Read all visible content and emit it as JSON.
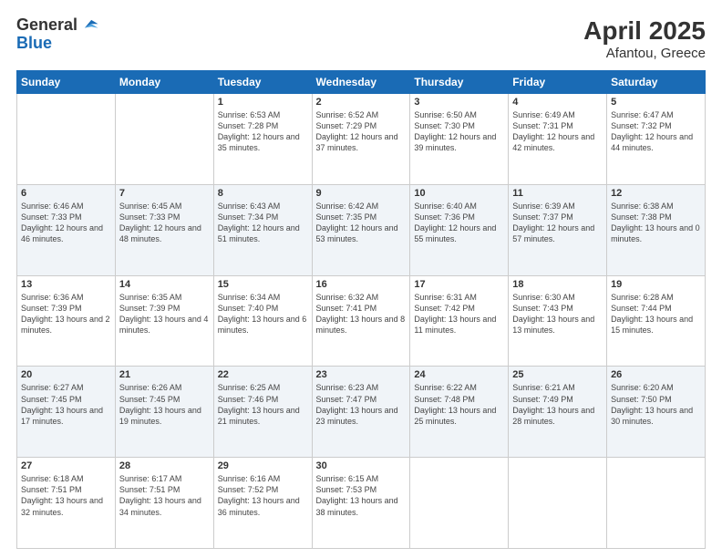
{
  "header": {
    "logo_general": "General",
    "logo_blue": "Blue",
    "month_year": "April 2025",
    "location": "Afantou, Greece"
  },
  "weekdays": [
    "Sunday",
    "Monday",
    "Tuesday",
    "Wednesday",
    "Thursday",
    "Friday",
    "Saturday"
  ],
  "weeks": [
    [
      {
        "day": "",
        "info": ""
      },
      {
        "day": "",
        "info": ""
      },
      {
        "day": "1",
        "info": "Sunrise: 6:53 AM\nSunset: 7:28 PM\nDaylight: 12 hours and 35 minutes."
      },
      {
        "day": "2",
        "info": "Sunrise: 6:52 AM\nSunset: 7:29 PM\nDaylight: 12 hours and 37 minutes."
      },
      {
        "day": "3",
        "info": "Sunrise: 6:50 AM\nSunset: 7:30 PM\nDaylight: 12 hours and 39 minutes."
      },
      {
        "day": "4",
        "info": "Sunrise: 6:49 AM\nSunset: 7:31 PM\nDaylight: 12 hours and 42 minutes."
      },
      {
        "day": "5",
        "info": "Sunrise: 6:47 AM\nSunset: 7:32 PM\nDaylight: 12 hours and 44 minutes."
      }
    ],
    [
      {
        "day": "6",
        "info": "Sunrise: 6:46 AM\nSunset: 7:33 PM\nDaylight: 12 hours and 46 minutes."
      },
      {
        "day": "7",
        "info": "Sunrise: 6:45 AM\nSunset: 7:33 PM\nDaylight: 12 hours and 48 minutes."
      },
      {
        "day": "8",
        "info": "Sunrise: 6:43 AM\nSunset: 7:34 PM\nDaylight: 12 hours and 51 minutes."
      },
      {
        "day": "9",
        "info": "Sunrise: 6:42 AM\nSunset: 7:35 PM\nDaylight: 12 hours and 53 minutes."
      },
      {
        "day": "10",
        "info": "Sunrise: 6:40 AM\nSunset: 7:36 PM\nDaylight: 12 hours and 55 minutes."
      },
      {
        "day": "11",
        "info": "Sunrise: 6:39 AM\nSunset: 7:37 PM\nDaylight: 12 hours and 57 minutes."
      },
      {
        "day": "12",
        "info": "Sunrise: 6:38 AM\nSunset: 7:38 PM\nDaylight: 13 hours and 0 minutes."
      }
    ],
    [
      {
        "day": "13",
        "info": "Sunrise: 6:36 AM\nSunset: 7:39 PM\nDaylight: 13 hours and 2 minutes."
      },
      {
        "day": "14",
        "info": "Sunrise: 6:35 AM\nSunset: 7:39 PM\nDaylight: 13 hours and 4 minutes."
      },
      {
        "day": "15",
        "info": "Sunrise: 6:34 AM\nSunset: 7:40 PM\nDaylight: 13 hours and 6 minutes."
      },
      {
        "day": "16",
        "info": "Sunrise: 6:32 AM\nSunset: 7:41 PM\nDaylight: 13 hours and 8 minutes."
      },
      {
        "day": "17",
        "info": "Sunrise: 6:31 AM\nSunset: 7:42 PM\nDaylight: 13 hours and 11 minutes."
      },
      {
        "day": "18",
        "info": "Sunrise: 6:30 AM\nSunset: 7:43 PM\nDaylight: 13 hours and 13 minutes."
      },
      {
        "day": "19",
        "info": "Sunrise: 6:28 AM\nSunset: 7:44 PM\nDaylight: 13 hours and 15 minutes."
      }
    ],
    [
      {
        "day": "20",
        "info": "Sunrise: 6:27 AM\nSunset: 7:45 PM\nDaylight: 13 hours and 17 minutes."
      },
      {
        "day": "21",
        "info": "Sunrise: 6:26 AM\nSunset: 7:45 PM\nDaylight: 13 hours and 19 minutes."
      },
      {
        "day": "22",
        "info": "Sunrise: 6:25 AM\nSunset: 7:46 PM\nDaylight: 13 hours and 21 minutes."
      },
      {
        "day": "23",
        "info": "Sunrise: 6:23 AM\nSunset: 7:47 PM\nDaylight: 13 hours and 23 minutes."
      },
      {
        "day": "24",
        "info": "Sunrise: 6:22 AM\nSunset: 7:48 PM\nDaylight: 13 hours and 25 minutes."
      },
      {
        "day": "25",
        "info": "Sunrise: 6:21 AM\nSunset: 7:49 PM\nDaylight: 13 hours and 28 minutes."
      },
      {
        "day": "26",
        "info": "Sunrise: 6:20 AM\nSunset: 7:50 PM\nDaylight: 13 hours and 30 minutes."
      }
    ],
    [
      {
        "day": "27",
        "info": "Sunrise: 6:18 AM\nSunset: 7:51 PM\nDaylight: 13 hours and 32 minutes."
      },
      {
        "day": "28",
        "info": "Sunrise: 6:17 AM\nSunset: 7:51 PM\nDaylight: 13 hours and 34 minutes."
      },
      {
        "day": "29",
        "info": "Sunrise: 6:16 AM\nSunset: 7:52 PM\nDaylight: 13 hours and 36 minutes."
      },
      {
        "day": "30",
        "info": "Sunrise: 6:15 AM\nSunset: 7:53 PM\nDaylight: 13 hours and 38 minutes."
      },
      {
        "day": "",
        "info": ""
      },
      {
        "day": "",
        "info": ""
      },
      {
        "day": "",
        "info": ""
      }
    ]
  ]
}
